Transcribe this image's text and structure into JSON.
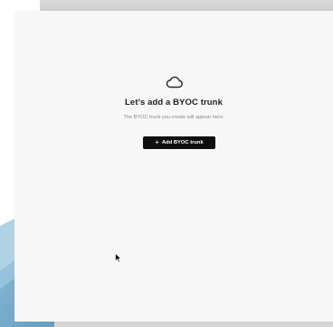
{
  "empty_state": {
    "icon": "cloud-icon",
    "title": "Let's add a BYOC trunk",
    "subtitle": "The BYOC trunk you create will appear here.",
    "button": {
      "icon": "plus-icon",
      "icon_glyph": "+",
      "label": "Add BYOC trunk"
    }
  },
  "colors": {
    "panel_background": "#f7f7f7",
    "button_background": "#0f0f0f",
    "button_text": "#ffffff",
    "title_text": "#1f1f1f",
    "subtitle_text": "#8a8a8a",
    "backdrop_accent": "#6aa6c8"
  }
}
